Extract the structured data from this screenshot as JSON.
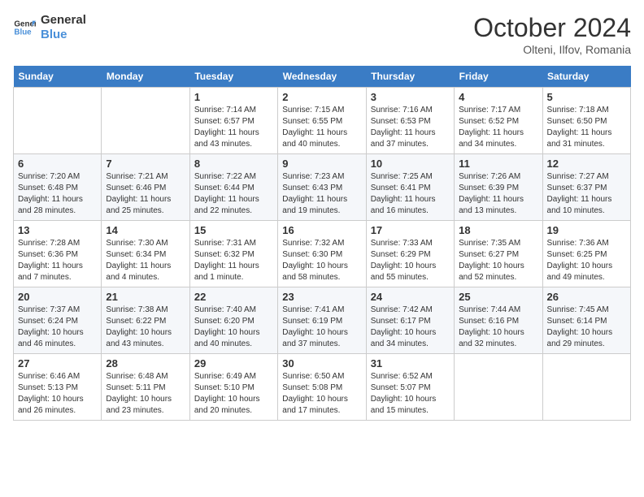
{
  "header": {
    "logo_line1": "General",
    "logo_line2": "Blue",
    "month": "October 2024",
    "location": "Olteni, Ilfov, Romania"
  },
  "weekdays": [
    "Sunday",
    "Monday",
    "Tuesday",
    "Wednesday",
    "Thursday",
    "Friday",
    "Saturday"
  ],
  "weeks": [
    [
      {
        "day": "",
        "content": ""
      },
      {
        "day": "",
        "content": ""
      },
      {
        "day": "1",
        "content": "Sunrise: 7:14 AM\nSunset: 6:57 PM\nDaylight: 11 hours and 43 minutes."
      },
      {
        "day": "2",
        "content": "Sunrise: 7:15 AM\nSunset: 6:55 PM\nDaylight: 11 hours and 40 minutes."
      },
      {
        "day": "3",
        "content": "Sunrise: 7:16 AM\nSunset: 6:53 PM\nDaylight: 11 hours and 37 minutes."
      },
      {
        "day": "4",
        "content": "Sunrise: 7:17 AM\nSunset: 6:52 PM\nDaylight: 11 hours and 34 minutes."
      },
      {
        "day": "5",
        "content": "Sunrise: 7:18 AM\nSunset: 6:50 PM\nDaylight: 11 hours and 31 minutes."
      }
    ],
    [
      {
        "day": "6",
        "content": "Sunrise: 7:20 AM\nSunset: 6:48 PM\nDaylight: 11 hours and 28 minutes."
      },
      {
        "day": "7",
        "content": "Sunrise: 7:21 AM\nSunset: 6:46 PM\nDaylight: 11 hours and 25 minutes."
      },
      {
        "day": "8",
        "content": "Sunrise: 7:22 AM\nSunset: 6:44 PM\nDaylight: 11 hours and 22 minutes."
      },
      {
        "day": "9",
        "content": "Sunrise: 7:23 AM\nSunset: 6:43 PM\nDaylight: 11 hours and 19 minutes."
      },
      {
        "day": "10",
        "content": "Sunrise: 7:25 AM\nSunset: 6:41 PM\nDaylight: 11 hours and 16 minutes."
      },
      {
        "day": "11",
        "content": "Sunrise: 7:26 AM\nSunset: 6:39 PM\nDaylight: 11 hours and 13 minutes."
      },
      {
        "day": "12",
        "content": "Sunrise: 7:27 AM\nSunset: 6:37 PM\nDaylight: 11 hours and 10 minutes."
      }
    ],
    [
      {
        "day": "13",
        "content": "Sunrise: 7:28 AM\nSunset: 6:36 PM\nDaylight: 11 hours and 7 minutes."
      },
      {
        "day": "14",
        "content": "Sunrise: 7:30 AM\nSunset: 6:34 PM\nDaylight: 11 hours and 4 minutes."
      },
      {
        "day": "15",
        "content": "Sunrise: 7:31 AM\nSunset: 6:32 PM\nDaylight: 11 hours and 1 minute."
      },
      {
        "day": "16",
        "content": "Sunrise: 7:32 AM\nSunset: 6:30 PM\nDaylight: 10 hours and 58 minutes."
      },
      {
        "day": "17",
        "content": "Sunrise: 7:33 AM\nSunset: 6:29 PM\nDaylight: 10 hours and 55 minutes."
      },
      {
        "day": "18",
        "content": "Sunrise: 7:35 AM\nSunset: 6:27 PM\nDaylight: 10 hours and 52 minutes."
      },
      {
        "day": "19",
        "content": "Sunrise: 7:36 AM\nSunset: 6:25 PM\nDaylight: 10 hours and 49 minutes."
      }
    ],
    [
      {
        "day": "20",
        "content": "Sunrise: 7:37 AM\nSunset: 6:24 PM\nDaylight: 10 hours and 46 minutes."
      },
      {
        "day": "21",
        "content": "Sunrise: 7:38 AM\nSunset: 6:22 PM\nDaylight: 10 hours and 43 minutes."
      },
      {
        "day": "22",
        "content": "Sunrise: 7:40 AM\nSunset: 6:20 PM\nDaylight: 10 hours and 40 minutes."
      },
      {
        "day": "23",
        "content": "Sunrise: 7:41 AM\nSunset: 6:19 PM\nDaylight: 10 hours and 37 minutes."
      },
      {
        "day": "24",
        "content": "Sunrise: 7:42 AM\nSunset: 6:17 PM\nDaylight: 10 hours and 34 minutes."
      },
      {
        "day": "25",
        "content": "Sunrise: 7:44 AM\nSunset: 6:16 PM\nDaylight: 10 hours and 32 minutes."
      },
      {
        "day": "26",
        "content": "Sunrise: 7:45 AM\nSunset: 6:14 PM\nDaylight: 10 hours and 29 minutes."
      }
    ],
    [
      {
        "day": "27",
        "content": "Sunrise: 6:46 AM\nSunset: 5:13 PM\nDaylight: 10 hours and 26 minutes."
      },
      {
        "day": "28",
        "content": "Sunrise: 6:48 AM\nSunset: 5:11 PM\nDaylight: 10 hours and 23 minutes."
      },
      {
        "day": "29",
        "content": "Sunrise: 6:49 AM\nSunset: 5:10 PM\nDaylight: 10 hours and 20 minutes."
      },
      {
        "day": "30",
        "content": "Sunrise: 6:50 AM\nSunset: 5:08 PM\nDaylight: 10 hours and 17 minutes."
      },
      {
        "day": "31",
        "content": "Sunrise: 6:52 AM\nSunset: 5:07 PM\nDaylight: 10 hours and 15 minutes."
      },
      {
        "day": "",
        "content": ""
      },
      {
        "day": "",
        "content": ""
      }
    ]
  ]
}
